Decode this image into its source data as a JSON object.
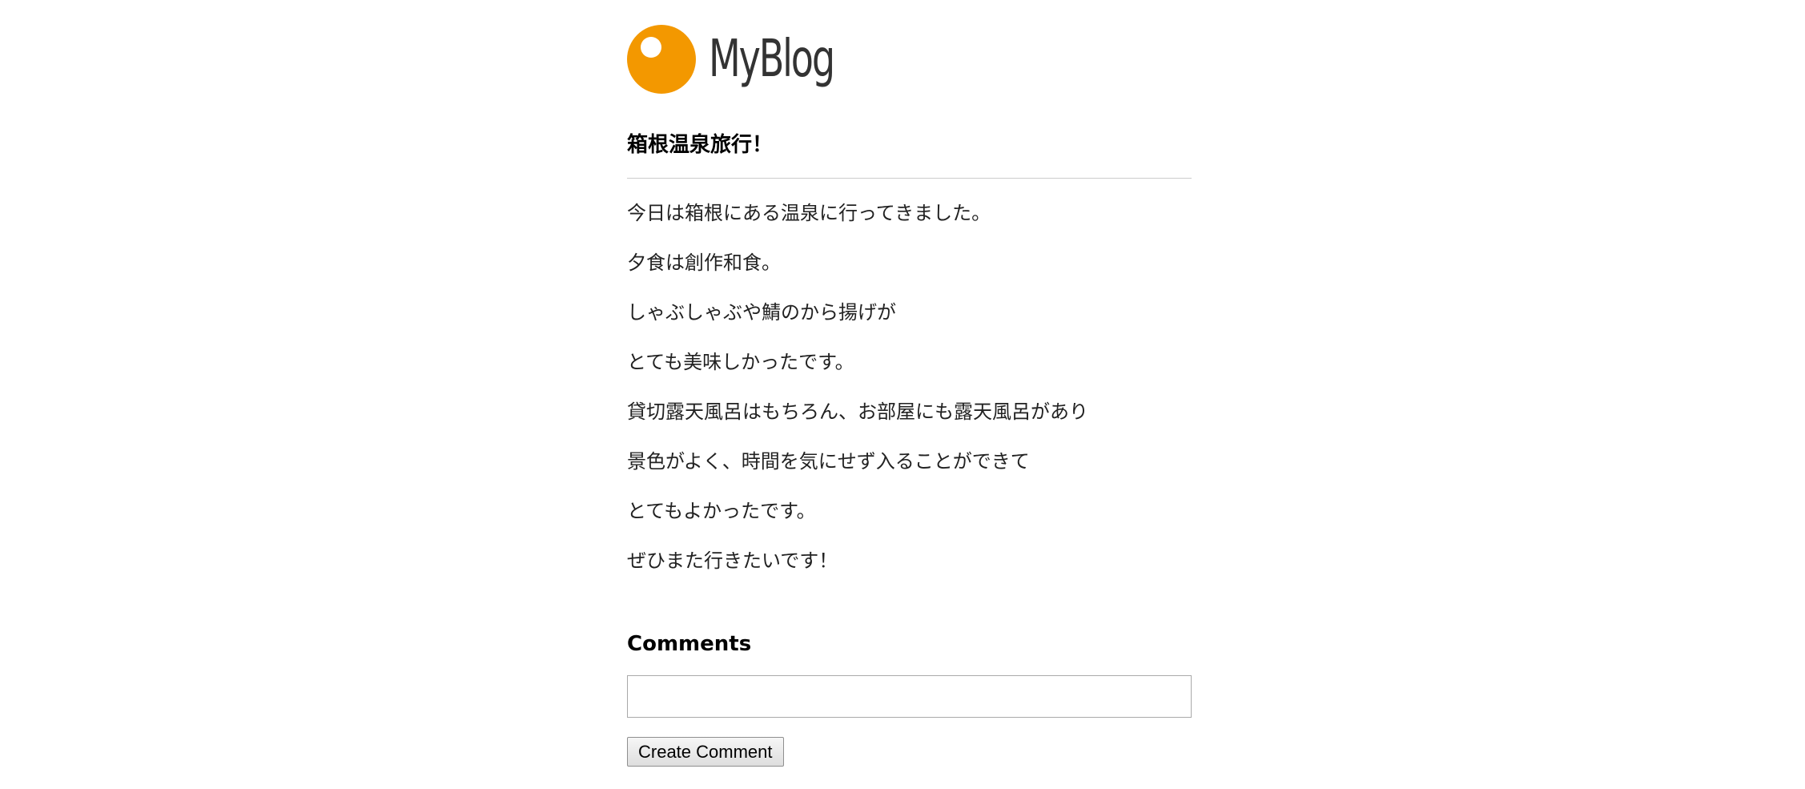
{
  "header": {
    "logo_text": "MyBlog",
    "logo_icon": "orange-circle-logo-icon",
    "accent_color": "#f39800"
  },
  "post": {
    "title": "箱根温泉旅行！",
    "paragraphs": [
      "今日は箱根にある温泉に行ってきました。",
      "夕食は創作和食。",
      "しゃぶしゃぶや鯖のから揚げが",
      "とても美味しかったです。",
      "貸切露天風呂はもちろん、お部屋にも露天風呂があり",
      "景色がよく、時間を気にせず入ることができて",
      "とてもよかったです。",
      "ぜひまた行きたいです！"
    ]
  },
  "comments": {
    "heading": "Comments",
    "input_value": "",
    "input_placeholder": "",
    "submit_label": "Create Comment"
  }
}
